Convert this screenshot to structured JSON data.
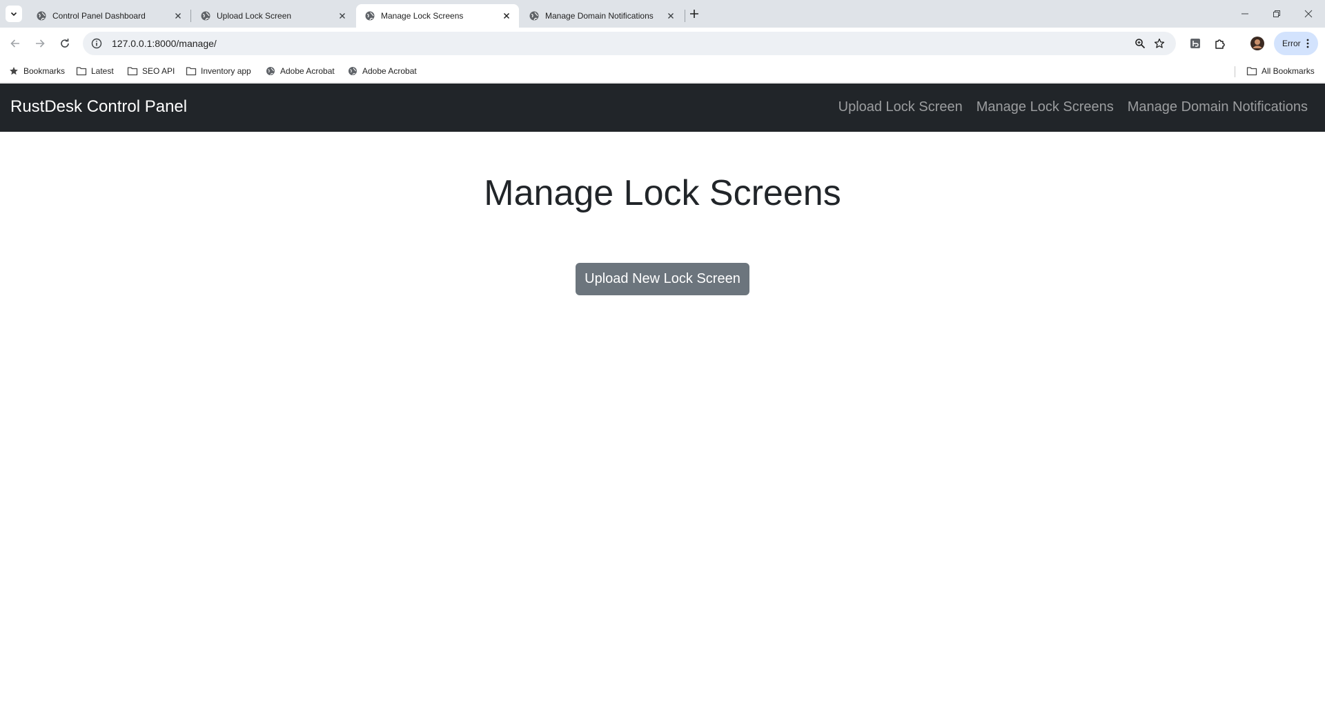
{
  "browser": {
    "tabs": [
      {
        "title": "Control Panel Dashboard",
        "active": false
      },
      {
        "title": "Upload Lock Screen",
        "active": false
      },
      {
        "title": "Manage Lock Screens",
        "active": true
      },
      {
        "title": "Manage Domain Notifications",
        "active": false
      }
    ],
    "url": "127.0.0.1:8000/manage/",
    "profile_status": "Error",
    "bookmarks": [
      {
        "label": "Bookmarks",
        "icon": "star-icon"
      },
      {
        "label": "Latest",
        "icon": "folder-icon"
      },
      {
        "label": "SEO API",
        "icon": "folder-icon"
      },
      {
        "label": "Inventory app",
        "icon": "folder-icon"
      },
      {
        "label": "Adobe Acrobat",
        "icon": "globe-icon"
      },
      {
        "label": "Adobe Acrobat",
        "icon": "globe-icon"
      }
    ],
    "all_bookmarks": "All Bookmarks"
  },
  "page": {
    "brand": "RustDesk Control Panel",
    "nav": [
      {
        "label": "Upload Lock Screen"
      },
      {
        "label": "Manage Lock Screens"
      },
      {
        "label": "Manage Domain Notifications"
      }
    ],
    "title": "Manage Lock Screens",
    "upload_button": "Upload New Lock Screen"
  },
  "colors": {
    "navbar_bg": "#212529",
    "button_bg": "#6c757d",
    "tabstrip_bg": "#dfe3e8",
    "error_pill_bg": "#d3e3fd"
  }
}
